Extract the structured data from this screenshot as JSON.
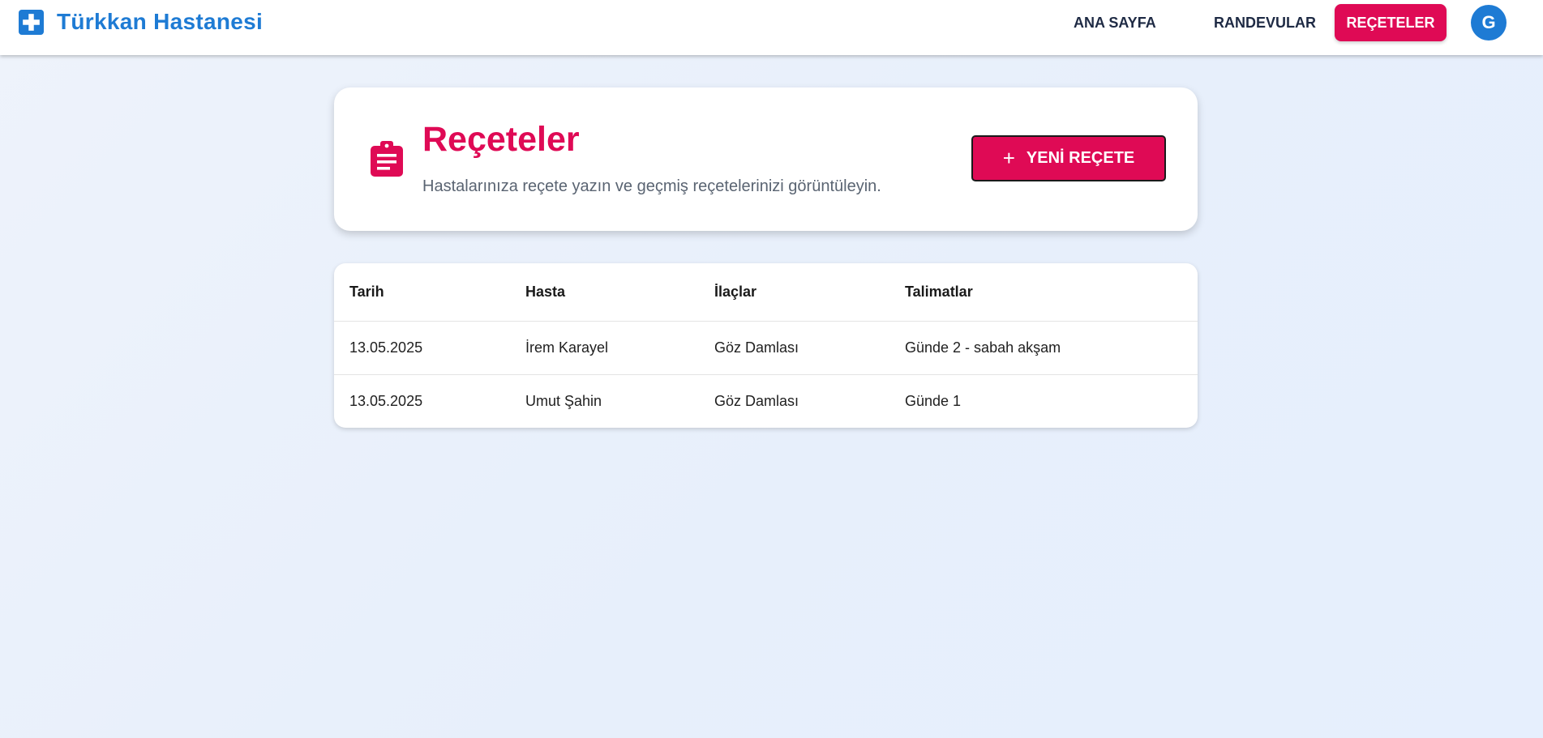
{
  "app": {
    "title": "Türkkan Hastanesi"
  },
  "nav": {
    "home": "ANA SAYFA",
    "appointments": "RANDEVULAR",
    "prescriptions": "REÇETELER",
    "avatar_initial": "G"
  },
  "header": {
    "title": "Reçeteler",
    "subtitle": "Hastalarınıza reçete yazın ve geçmiş reçetelerinizi görüntüleyin.",
    "new_button_label": "YENİ REÇETE",
    "icon": "clipboard-icon"
  },
  "table": {
    "columns": [
      "Tarih",
      "Hasta",
      "İlaçlar",
      "Talimatlar"
    ],
    "rows": [
      [
        "13.05.2025",
        "İrem Karayel",
        "Göz Damlası",
        "Günde 2 - sabah akşam"
      ],
      [
        "13.05.2025",
        "Umut Şahin",
        "Göz Damlası",
        "Günde 1"
      ]
    ]
  },
  "colors": {
    "brand_blue": "#1e7bd4",
    "accent_pink": "#df0a55",
    "nav_text": "#1e2a44"
  }
}
